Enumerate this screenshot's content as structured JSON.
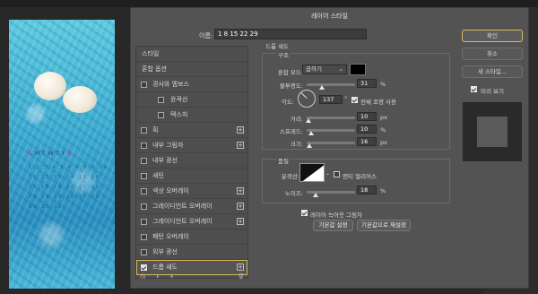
{
  "dialog": {
    "title": "레이어 스타일",
    "name_label": "이름:",
    "name_value": "1 8 15 22 29"
  },
  "calendar": {
    "days": [
      "S",
      "M",
      "T",
      "W",
      "T",
      "F",
      "S"
    ],
    "numbers": "1 2 3 4 5 6 7 8 9 10 11 12 13 14 15 16 17 18 19 20 21 22 23 24 25 26 27 28 29 30 31"
  },
  "styles": [
    {
      "label": "스타일",
      "checkbox": false,
      "plus": false,
      "indent": false
    },
    {
      "label": "혼합 옵션",
      "checkbox": false,
      "plus": false,
      "indent": false
    },
    {
      "label": "경사와 엠보스",
      "checkbox": true,
      "checked": false,
      "plus": false,
      "indent": false
    },
    {
      "label": "윤곽선",
      "checkbox": true,
      "checked": false,
      "plus": false,
      "indent": true
    },
    {
      "label": "텍스처",
      "checkbox": true,
      "checked": false,
      "plus": false,
      "indent": true
    },
    {
      "label": "획",
      "checkbox": true,
      "checked": false,
      "plus": true,
      "indent": false
    },
    {
      "label": "내부 그림자",
      "checkbox": true,
      "checked": false,
      "plus": true,
      "indent": false
    },
    {
      "label": "내부 광선",
      "checkbox": true,
      "checked": false,
      "plus": false,
      "indent": false
    },
    {
      "label": "새틴",
      "checkbox": true,
      "checked": false,
      "plus": false,
      "indent": false
    },
    {
      "label": "색상 오버레이",
      "checkbox": true,
      "checked": false,
      "plus": true,
      "indent": false
    },
    {
      "label": "그레이디언트 오버레이",
      "checkbox": true,
      "checked": false,
      "plus": true,
      "indent": false
    },
    {
      "label": "그레이디언트 오버레이",
      "checkbox": true,
      "checked": false,
      "plus": true,
      "indent": false
    },
    {
      "label": "패턴 오버레이",
      "checkbox": true,
      "checked": false,
      "plus": false,
      "indent": false
    },
    {
      "label": "외부 광선",
      "checkbox": true,
      "checked": false,
      "plus": false,
      "indent": false
    },
    {
      "label": "드롭 섀도",
      "checkbox": true,
      "checked": true,
      "plus": true,
      "indent": false,
      "selected": true
    }
  ],
  "footer": {
    "fx": "fx",
    "up": "⬆",
    "down": "⬇",
    "trash": "🗑"
  },
  "panel": {
    "title": "드롭 섀도",
    "structure_title": "구조",
    "blend_mode_label": "혼합 모드:",
    "blend_mode_value": "곱하기",
    "chevron": "⌄",
    "swatch_color": "#000000",
    "opacity_label": "불투명도:",
    "opacity_value": "31",
    "opacity_unit": "%",
    "opacity_fraction": 0.31,
    "angle_label": "각도:",
    "angle_value": "137",
    "angle_unit": "°",
    "global_light_label": "전체 조명 사용",
    "global_light_checked": true,
    "distance_label": "거리:",
    "distance_value": "10",
    "distance_unit": "px",
    "distance_fraction": 0.04,
    "spread_label": "스프레드:",
    "spread_value": "10",
    "spread_unit": "%",
    "spread_fraction": 0.1,
    "size_label": "크기:",
    "size_value": "16",
    "size_unit": "px",
    "size_fraction": 0.06,
    "quality_title": "품질",
    "contour_label": "윤곽선:",
    "anti_alias_label": "앤티 앨리어스",
    "anti_alias_checked": false,
    "noise_label": "노이즈:",
    "noise_value": "18",
    "noise_unit": "%",
    "noise_fraction": 0.18,
    "knockout_label": "레이어 녹아웃 그림자",
    "knockout_checked": true,
    "make_default_label": "기본값 설정",
    "reset_default_label": "기본값으로 재설정"
  },
  "buttons": {
    "ok": "확인",
    "cancel": "취소",
    "new_style": "새 스타일...",
    "preview_label": "미리 보기",
    "preview_checked": true
  }
}
